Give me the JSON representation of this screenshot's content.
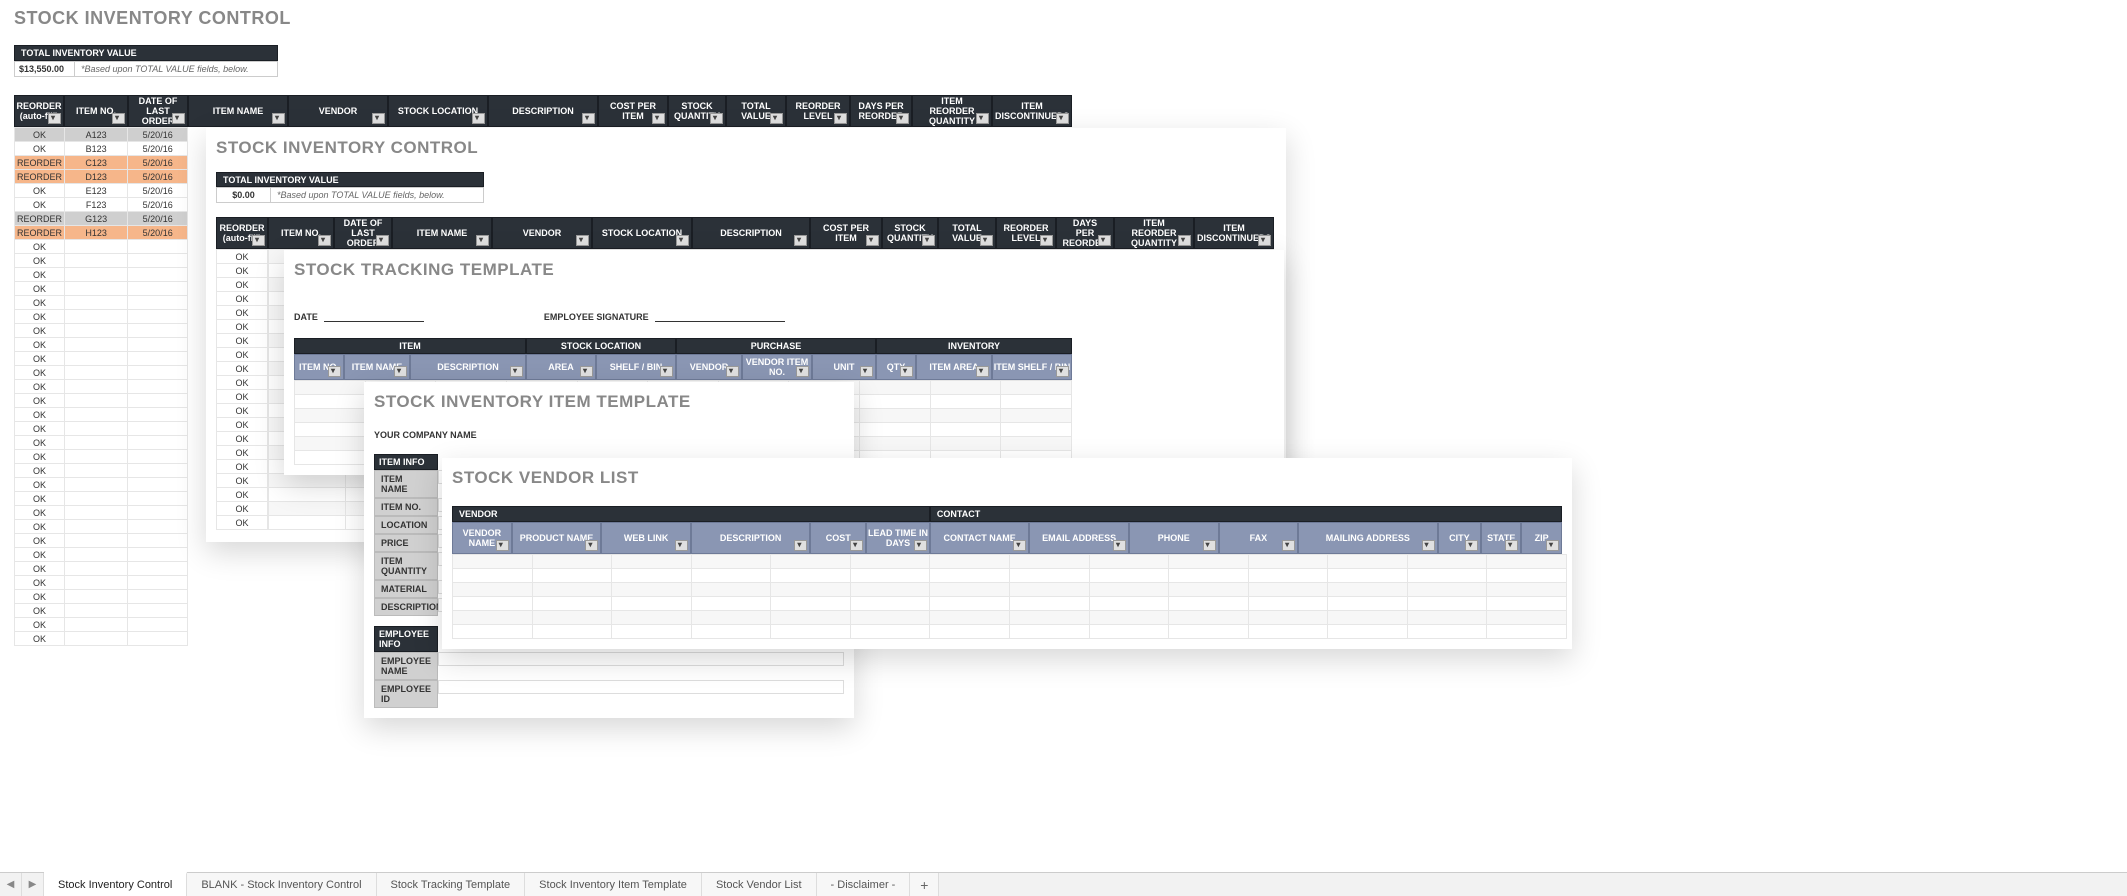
{
  "sheet1": {
    "title": "STOCK INVENTORY CONTROL",
    "total_label": "TOTAL INVENTORY VALUE",
    "total_value": "$13,550.00",
    "total_note": "*Based upon TOTAL VALUE fields, below.",
    "headers": [
      "REORDER (auto-fill)",
      "ITEM NO.",
      "DATE OF LAST ORDER",
      "ITEM NAME",
      "VENDOR",
      "STOCK LOCATION",
      "DESCRIPTION",
      "COST PER ITEM",
      "STOCK QUANTITY",
      "TOTAL VALUE",
      "REORDER LEVEL",
      "DAYS PER REORDER",
      "ITEM REORDER QUANTITY",
      "ITEM DISCONTINUED?"
    ],
    "rows": [
      {
        "status": "OK",
        "item": "A123",
        "date": "5/20/16",
        "style": "gray"
      },
      {
        "status": "OK",
        "item": "B123",
        "date": "5/20/16",
        "style": "ok"
      },
      {
        "status": "REORDER",
        "item": "C123",
        "date": "5/20/16",
        "style": "orange"
      },
      {
        "status": "REORDER",
        "item": "D123",
        "date": "5/20/16",
        "style": "orange"
      },
      {
        "status": "OK",
        "item": "E123",
        "date": "5/20/16",
        "style": "ok"
      },
      {
        "status": "OK",
        "item": "F123",
        "date": "5/20/16",
        "style": "ok"
      },
      {
        "status": "REORDER",
        "item": "G123",
        "date": "5/20/16",
        "style": "gray"
      },
      {
        "status": "REORDER",
        "item": "H123",
        "date": "5/20/16",
        "style": "orange"
      }
    ],
    "ok_label": "OK",
    "extra_ok_rows": 29
  },
  "sheet2": {
    "title": "STOCK INVENTORY CONTROL",
    "total_label": "TOTAL INVENTORY VALUE",
    "total_value": "$0.00",
    "total_note": "*Based upon TOTAL VALUE fields, below.",
    "headers": [
      "REORDER (auto-fill)",
      "ITEM NO.",
      "DATE OF LAST ORDER",
      "ITEM NAME",
      "VENDOR",
      "STOCK LOCATION",
      "DESCRIPTION",
      "COST PER ITEM",
      "STOCK QUANTITY",
      "TOTAL VALUE",
      "REORDER LEVEL",
      "DAYS PER REORDER",
      "ITEM REORDER QUANTITY",
      "ITEM DISCONTINUED?"
    ],
    "ok_label": "OK",
    "extra_ok_rows": 20
  },
  "sheet3": {
    "title": "STOCK TRACKING TEMPLATE",
    "date_label": "DATE",
    "sig_label": "EMPLOYEE SIGNATURE",
    "groups": [
      "ITEM",
      "STOCK LOCATION",
      "PURCHASE",
      "INVENTORY"
    ],
    "subs": [
      "ITEM NO.",
      "ITEM NAME",
      "DESCRIPTION",
      "AREA",
      "SHELF / BIN",
      "VENDOR",
      "VENDOR ITEM NO.",
      "UNIT",
      "QTY",
      "ITEM AREA",
      "ITEM SHELF / BIN"
    ]
  },
  "sheet4": {
    "title": "STOCK INVENTORY ITEM TEMPLATE",
    "company": "YOUR COMPANY NAME",
    "item_info": "ITEM INFO",
    "item_rows": [
      "ITEM NAME",
      "ITEM NO.",
      "LOCATION",
      "PRICE",
      "ITEM QUANTITY",
      "MATERIAL",
      "DESCRIPTION"
    ],
    "emp_info": "EMPLOYEE INFO",
    "emp_rows": [
      "EMPLOYEE NAME",
      "EMPLOYEE ID"
    ]
  },
  "sheet5": {
    "title": "STOCK VENDOR LIST",
    "groups": [
      "VENDOR",
      "CONTACT"
    ],
    "subs": [
      "VENDOR NAME",
      "PRODUCT NAME",
      "WEB LINK",
      "DESCRIPTION",
      "COST",
      "LEAD TIME IN DAYS",
      "CONTACT NAME",
      "EMAIL ADDRESS",
      "PHONE",
      "FAX",
      "MAILING ADDRESS",
      "CITY",
      "STATE",
      "ZIP"
    ]
  },
  "tabs": [
    "Stock Inventory Control",
    "BLANK - Stock Inventory Control",
    "Stock Tracking Template",
    "Stock Inventory Item Template",
    "Stock Vendor List",
    "- Disclaimer -"
  ],
  "nav": {
    "prev": "◀",
    "next": "▶",
    "add": "+"
  }
}
